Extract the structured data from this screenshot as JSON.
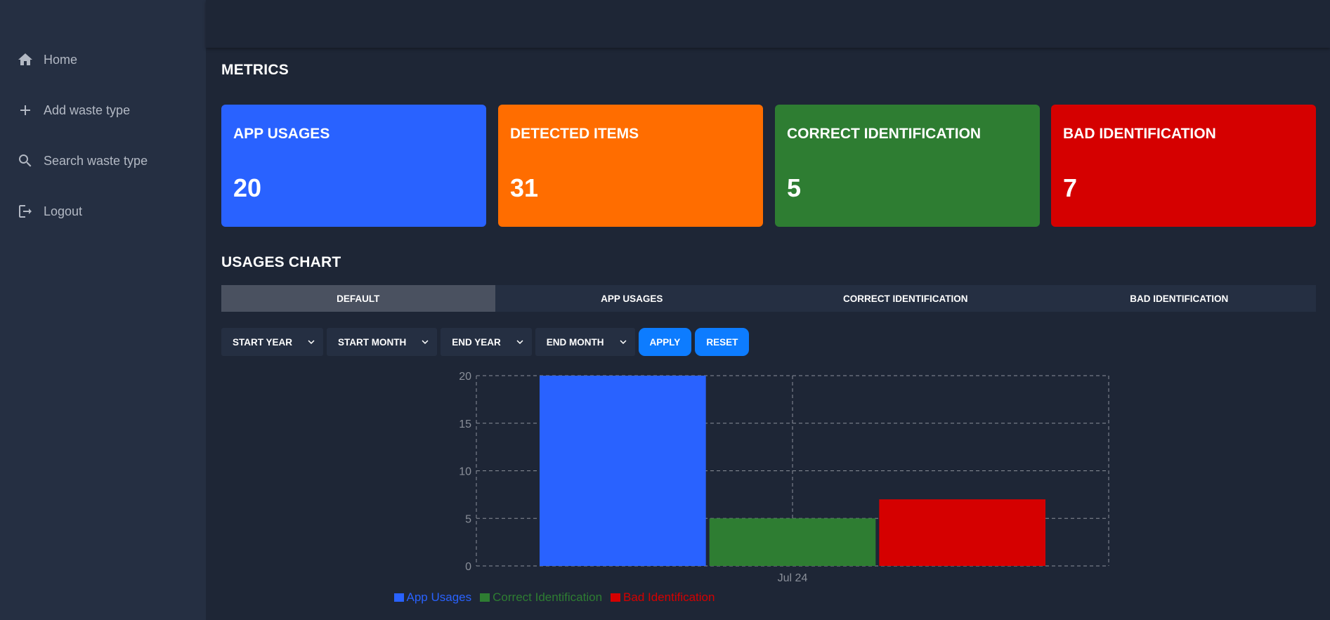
{
  "sidebar": {
    "items": [
      {
        "label": "Home",
        "icon": "home-icon"
      },
      {
        "label": "Add waste type",
        "icon": "plus-icon"
      },
      {
        "label": "Search waste type",
        "icon": "search-icon"
      },
      {
        "label": "Logout",
        "icon": "logout-icon"
      }
    ]
  },
  "metrics": {
    "title": "METRICS",
    "cards": [
      {
        "title": "APP USAGES",
        "value": "20",
        "color": "#2962ff"
      },
      {
        "title": "DETECTED ITEMS",
        "value": "31",
        "color": "#ff6d00"
      },
      {
        "title": "CORRECT IDENTIFICATION",
        "value": "5",
        "color": "#2e7d32"
      },
      {
        "title": "BAD IDENTIFICATION",
        "value": "7",
        "color": "#d50000"
      }
    ]
  },
  "usages": {
    "title": "USAGES CHART",
    "tabs": [
      "DEFAULT",
      "APP USAGES",
      "CORRECT IDENTIFICATION",
      "BAD IDENTIFICATION"
    ],
    "active_tab": "DEFAULT",
    "filters": [
      "START YEAR",
      "START MONTH",
      "END YEAR",
      "END MONTH"
    ],
    "apply_label": "APPLY",
    "reset_label": "RESET"
  },
  "chart_data": {
    "type": "bar",
    "categories": [
      "Jul 24"
    ],
    "series": [
      {
        "name": "App Usages",
        "values": [
          20
        ],
        "color": "#2962ff"
      },
      {
        "name": "Correct Identification",
        "values": [
          5
        ],
        "color": "#2e7d32"
      },
      {
        "name": "Bad Identification",
        "values": [
          7
        ],
        "color": "#d50000"
      }
    ],
    "ylim": [
      0,
      20
    ],
    "yticks": [
      "0",
      "5",
      "10",
      "15",
      "20"
    ],
    "grid": true,
    "legend": "bottom"
  }
}
